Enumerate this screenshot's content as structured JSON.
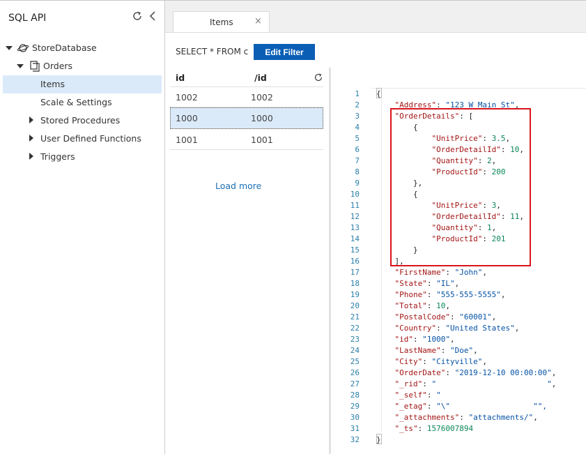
{
  "sidebar": {
    "title": "SQL API",
    "database": "StoreDatabase",
    "container": "Orders",
    "items": [
      "Items",
      "Scale & Settings",
      "Stored Procedures",
      "User Defined Functions",
      "Triggers"
    ]
  },
  "tab": {
    "label": "Items",
    "close": "×"
  },
  "query": {
    "text": "SELECT * FROM c",
    "edit_filter": "Edit Filter"
  },
  "results": {
    "headers": [
      "id",
      "/id"
    ],
    "rows": [
      [
        "1002",
        "1002"
      ],
      [
        "1000",
        "1000"
      ],
      [
        "1001",
        "1001"
      ]
    ],
    "selected_row": 1,
    "load_more": "Load more"
  },
  "editor": {
    "lines": [
      "{",
      "    \"Address\": \"123 W Main St\",",
      "    \"OrderDetails\": [",
      "        {",
      "            \"UnitPrice\": 3.5,",
      "            \"OrderDetailId\": 10,",
      "            \"Quantity\": 2,",
      "            \"ProductId\": 200",
      "        },",
      "        {",
      "            \"UnitPrice\": 3,",
      "            \"OrderDetailId\": 11,",
      "            \"Quantity\": 1,",
      "            \"ProductId\": 201",
      "        }",
      "    ],",
      "    \"FirstName\": \"John\",",
      "    \"State\": \"IL\",",
      "    \"Phone\": \"555-555-5555\",",
      "    \"Total\": 10,",
      "    \"PostalCode\": \"60001\",",
      "    \"Country\": \"United States\",",
      "    \"id\": \"1000\",",
      "    \"LastName\": \"Doe\",",
      "    \"City\": \"Cityville\",",
      "    \"OrderDate\": \"2019-12-10 00:00:00\",",
      "    \"_rid\": \"                        \",",
      "    \"_self\": \"",
      "    \"_etag\": \"\\\"                  \"\",",
      "    \"_attachments\": \"attachments/\",",
      "    \"_ts\": 1576007894",
      "}"
    ]
  },
  "colors": {
    "accent": "#0a5fb5",
    "highlight_box": "#d9141b",
    "selection": "#dbeaf9"
  }
}
